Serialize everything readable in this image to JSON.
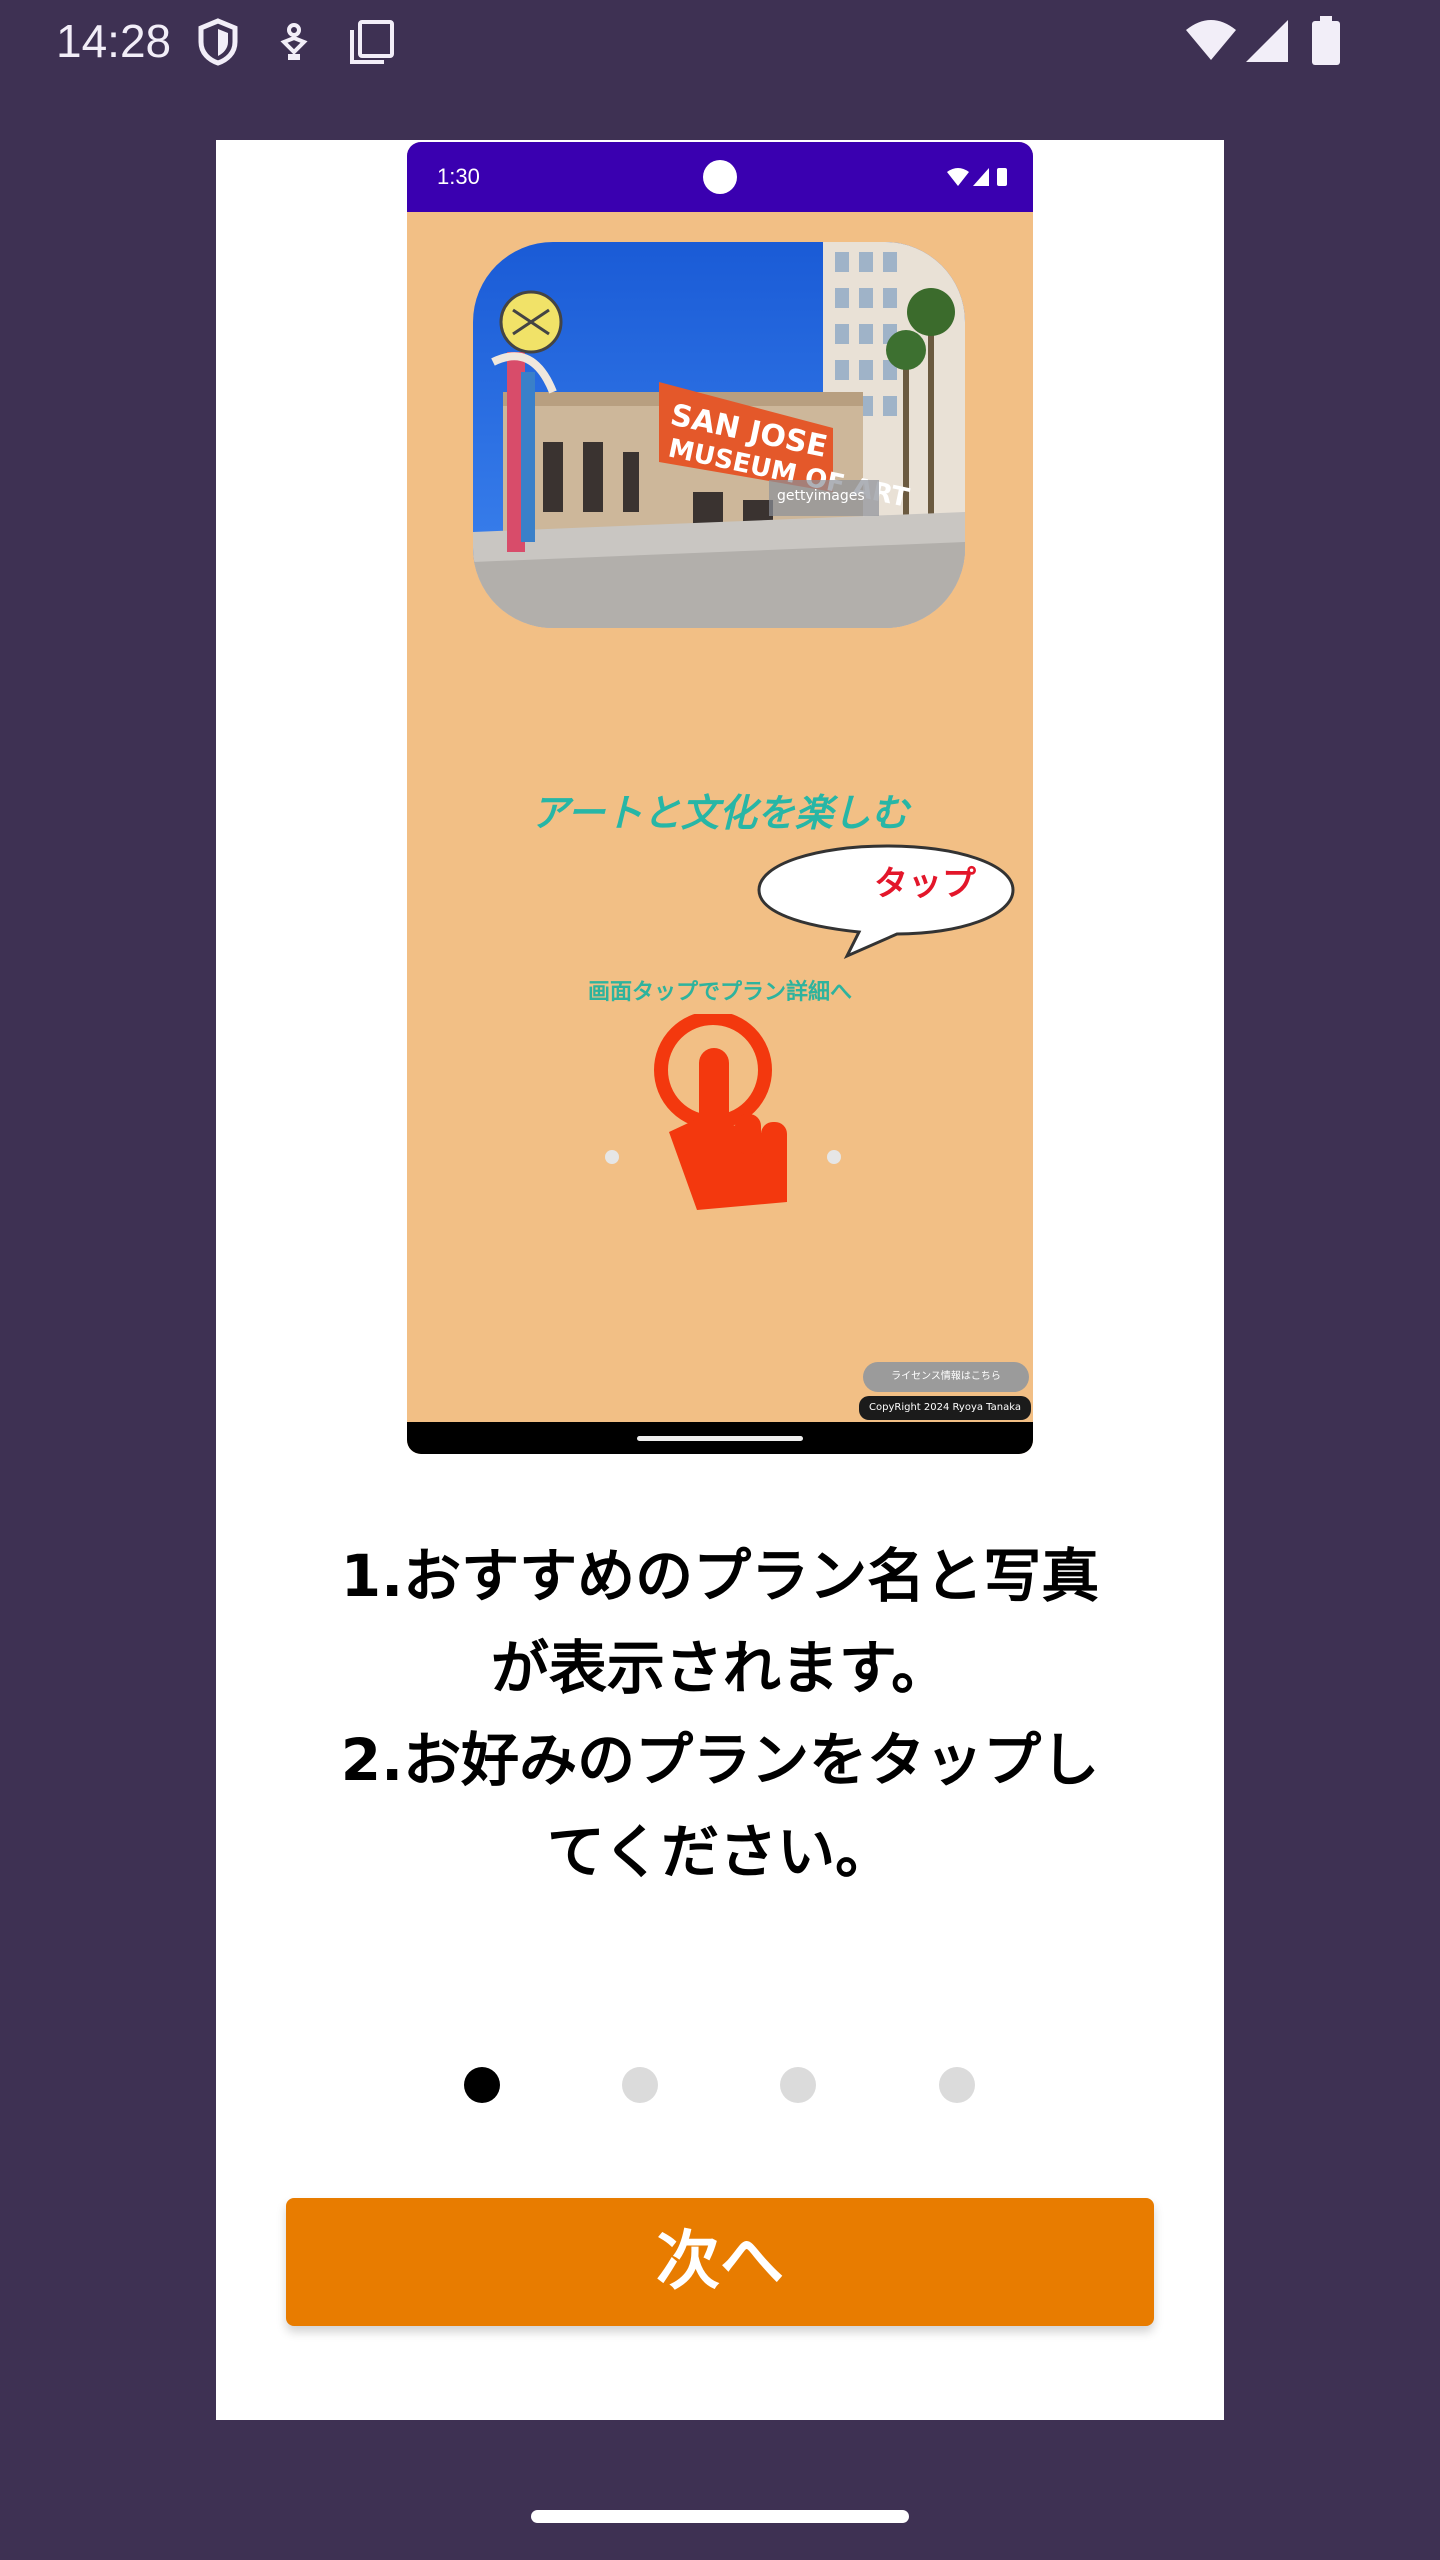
{
  "status_bar": {
    "time": "14:28",
    "icons_left": [
      "shield-icon",
      "usb-debug-icon",
      "copy-icon"
    ],
    "icons_right": [
      "wifi-icon",
      "signal-icon",
      "battery-icon"
    ]
  },
  "dialog": {
    "preview": {
      "status_time": "1:30",
      "photo_description_icon": "museum-photo",
      "headline": "アートと文化を楽しむ",
      "bubble_text": "タップ",
      "subtitle": "画面タップでプラン詳細へ",
      "license_button": "ライセンス情報はこちら",
      "copyright": "CopyRight 2024 Ryoya Tanaka",
      "accent_color": "#f2bf85"
    },
    "description_lines": [
      "1.おすすめのプラン名と写真",
      "が表示されます。",
      "2.お好みのプランをタップし",
      "てください。"
    ],
    "pager": {
      "total": 4,
      "current": 1
    },
    "next_button_label": "次へ",
    "button_color": "#e87c00"
  }
}
